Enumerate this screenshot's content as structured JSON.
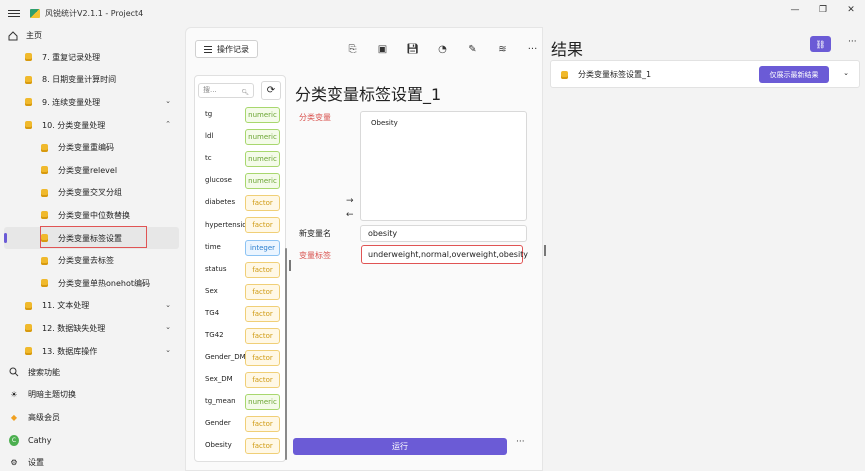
{
  "window": {
    "title": "风锐统计V2.1.1 - Project4",
    "controls": [
      "—",
      "❐",
      "✕"
    ]
  },
  "sidebar": {
    "home": "主页",
    "items": [
      {
        "label": "7. 重复记录处理",
        "level": 1,
        "chevron": ""
      },
      {
        "label": "8. 日期变量计算时间",
        "level": 1,
        "chevron": ""
      },
      {
        "label": "9. 连续变量处理",
        "level": 1,
        "chevron": "⌄"
      },
      {
        "label": "10. 分类变量处理",
        "level": 1,
        "chevron": "⌃"
      },
      {
        "label": "分类变量重编码",
        "level": 2,
        "chevron": ""
      },
      {
        "label": "分类变量relevel",
        "level": 2,
        "chevron": ""
      },
      {
        "label": "分类变量交叉分组",
        "level": 2,
        "chevron": ""
      },
      {
        "label": "分类变量中位数替换",
        "level": 2,
        "chevron": ""
      },
      {
        "label": "分类变量标签设置",
        "level": 2,
        "chevron": "",
        "active": true
      },
      {
        "label": "分类变量去标签",
        "level": 2,
        "chevron": ""
      },
      {
        "label": "分类变量单热onehot编码",
        "level": 2,
        "chevron": ""
      },
      {
        "label": "11. 文本处理",
        "level": 1,
        "chevron": "⌄"
      },
      {
        "label": "12. 数据缺失处理",
        "level": 1,
        "chevron": "⌄"
      },
      {
        "label": "13. 数据库操作",
        "level": 1,
        "chevron": "⌄"
      }
    ],
    "bottom": {
      "search": "搜索功能",
      "theme": "明暗主题切换",
      "vip": "高级会员",
      "user": "Cathy",
      "user_initial": "C",
      "settings": "设置"
    }
  },
  "toolbar": {
    "log_button": "操作记录",
    "icons": [
      "export-icon",
      "excel-icon",
      "save-icon",
      "clipboard-icon",
      "wrench-icon",
      "database-icon",
      "more-icon"
    ]
  },
  "varlist": {
    "search_placeholder": "搜...",
    "vars": [
      {
        "name": "tg",
        "type": "numeric"
      },
      {
        "name": "ldl",
        "type": "numeric"
      },
      {
        "name": "tc",
        "type": "numeric"
      },
      {
        "name": "glucose",
        "type": "numeric"
      },
      {
        "name": "diabetes",
        "type": "factor"
      },
      {
        "name": "hypertension",
        "type": "factor"
      },
      {
        "name": "time",
        "type": "integer"
      },
      {
        "name": "status",
        "type": "factor"
      },
      {
        "name": "Sex",
        "type": "factor"
      },
      {
        "name": "TG4",
        "type": "factor"
      },
      {
        "name": "TG42",
        "type": "factor"
      },
      {
        "name": "Gender_DM",
        "type": "factor"
      },
      {
        "name": "Sex_DM",
        "type": "factor"
      },
      {
        "name": "tg_mean",
        "type": "numeric"
      },
      {
        "name": "Gender",
        "type": "factor"
      },
      {
        "name": "Obesity",
        "type": "factor"
      }
    ]
  },
  "form": {
    "title": "分类变量标签设置_1",
    "cat_var_label": "分类变量",
    "cat_var_value": "Obesity",
    "new_var_label": "新变量名",
    "new_var_value": "obesity",
    "var_labels_label": "变量标签",
    "var_labels_value": "underweight,normal,overweight,obesity",
    "run_button": "运行",
    "more": "···"
  },
  "result": {
    "title": "结果",
    "item_title": "分类变量标签设置_1",
    "show_latest": "仅展示最新结果",
    "more": "···"
  },
  "colors": {
    "accent": "#6b5bd6",
    "error": "#d9534f"
  }
}
